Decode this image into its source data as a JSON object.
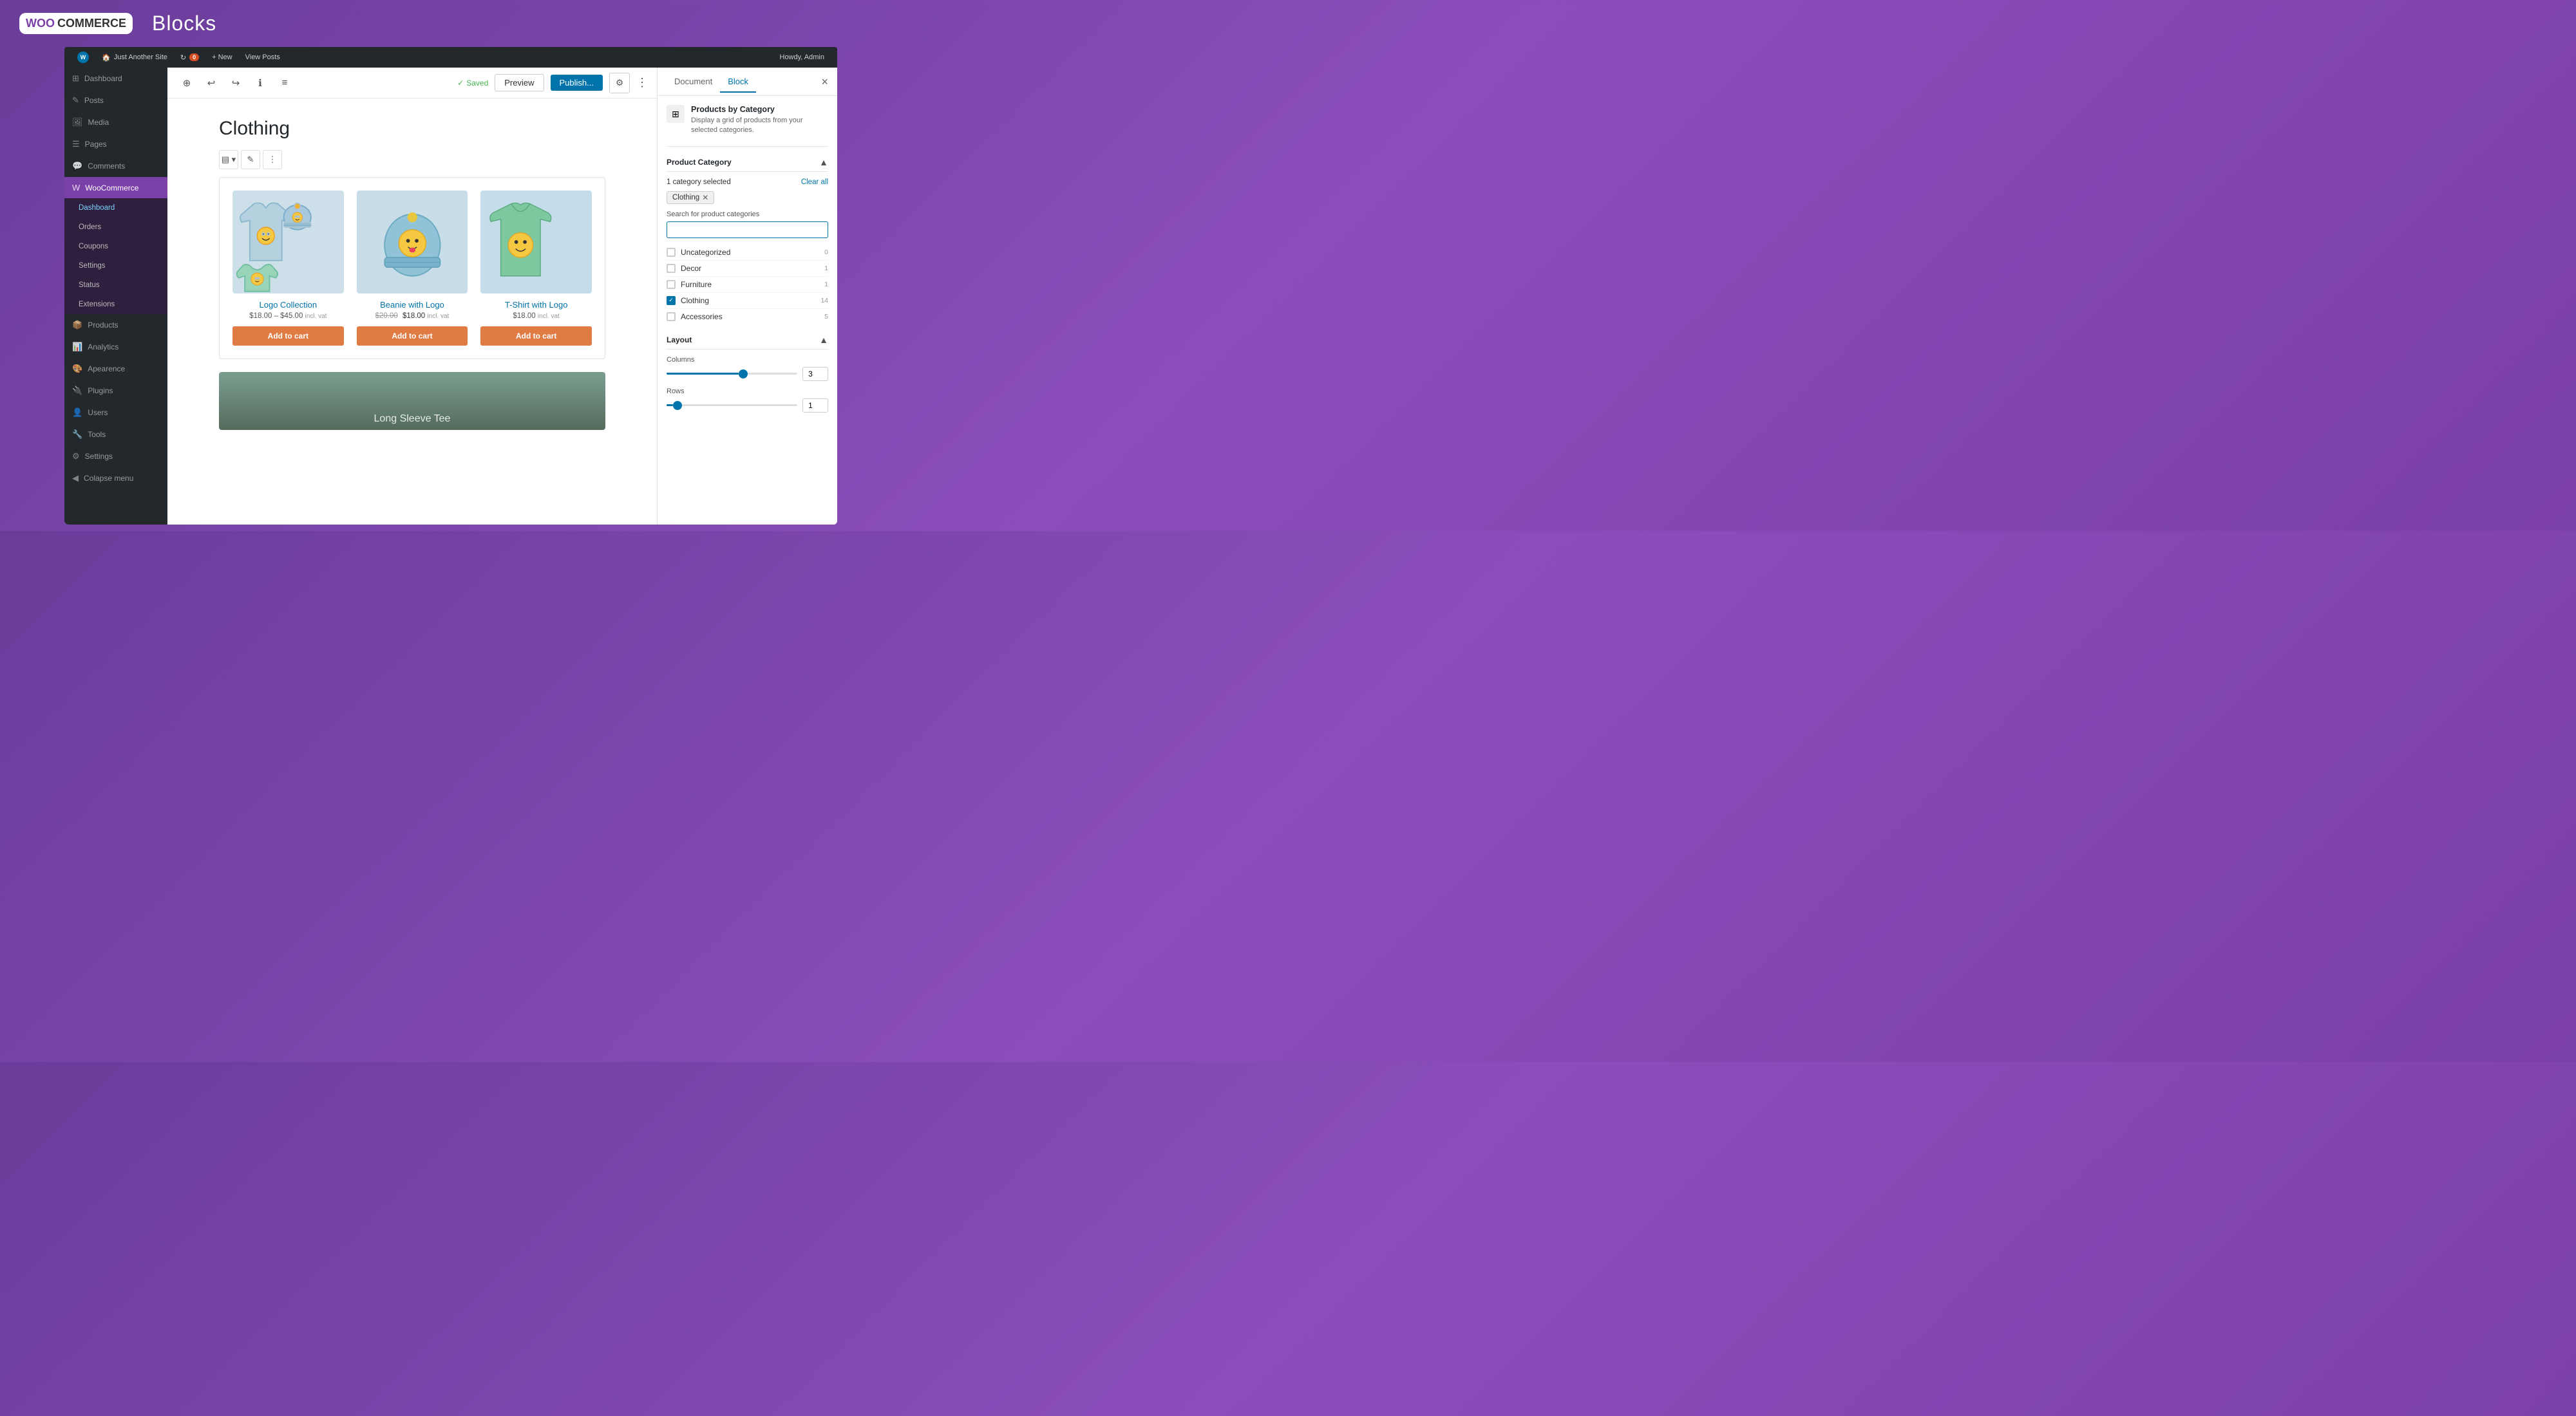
{
  "header": {
    "logo_woo": "WOO",
    "logo_commerce": "COMMERCE",
    "title": "Blocks"
  },
  "admin_bar": {
    "wp_label": "W",
    "site_name": "Just Another Site",
    "updates_count": "0",
    "new_label": "+ New",
    "view_posts": "View Posts",
    "howdy": "Howdy, Admin"
  },
  "sidebar": {
    "dashboard": "Dashboard",
    "posts": "Posts",
    "media": "Media",
    "pages": "Pages",
    "comments": "Comments",
    "woocommerce": "WooCommerce",
    "sub_dashboard": "Dashboard",
    "sub_orders": "Orders",
    "sub_coupons": "Coupons",
    "sub_settings": "Settings",
    "sub_status": "Status",
    "sub_extensions": "Extensions",
    "products": "Products",
    "analytics": "Analytics",
    "appearance": "Apearence",
    "plugins": "Plugins",
    "users": "Users",
    "tools": "Tools",
    "settings": "Settings",
    "collapse": "Colapse menu"
  },
  "toolbar": {
    "saved": "Saved",
    "preview": "Preview",
    "publish": "Publish..."
  },
  "page": {
    "title": "Clothing"
  },
  "products_block": {
    "products": [
      {
        "name": "Logo Collection",
        "price_original": "",
        "price_min": "$18.00",
        "price_max": "$45.00",
        "incl_vat": "incl. vat",
        "add_to_cart": "Add to cart",
        "bg_color": "#cde0ea"
      },
      {
        "name": "Beanie with Logo",
        "price_original": "$20.00",
        "price_sale": "$18.00",
        "incl_vat": "incl. vat",
        "add_to_cart": "Add to cart",
        "bg_color": "#c8dde8"
      },
      {
        "name": "T-Shirt with Logo",
        "price_original": "",
        "price_min": "$18.00",
        "price_max": "",
        "incl_vat": "incl. vat",
        "add_to_cart": "Add to cart",
        "bg_color": "#c5dcea"
      }
    ],
    "second_product": "Long Sleeve Tee"
  },
  "right_panel": {
    "tab_document": "Document",
    "tab_block": "Block",
    "block_name": "Products by Category",
    "block_desc": "Display a grid of products from your selected categories.",
    "product_category_section": "Product Category",
    "selected_count": "1 category selected",
    "clear_all": "Clear all",
    "selected_tag": "Clothing",
    "search_label": "Search for product categories",
    "search_placeholder": "",
    "categories": [
      {
        "name": "Uncategorized",
        "count": "0",
        "checked": false
      },
      {
        "name": "Decor",
        "count": "1",
        "checked": false
      },
      {
        "name": "Furniture",
        "count": "1",
        "checked": false
      },
      {
        "name": "Clothing",
        "count": "14",
        "checked": true
      },
      {
        "name": "Accessories",
        "count": "5",
        "checked": false
      }
    ],
    "layout_section": "Layout",
    "columns_label": "Columns",
    "columns_value": "3",
    "rows_label": "Rows",
    "rows_value": "1"
  }
}
